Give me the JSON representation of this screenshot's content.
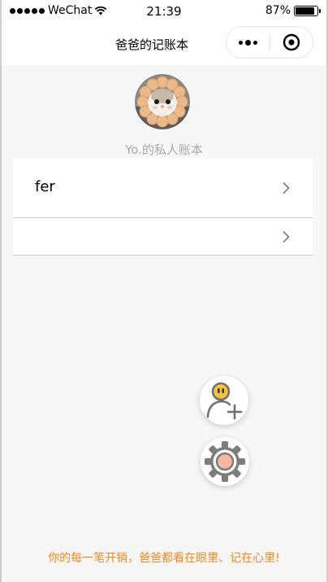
{
  "status_bar": {
    "carrier": "WeChat",
    "time": "21:39",
    "battery_text": "87%",
    "battery_level": 0.87,
    "signal_icon": "signal-dots-icon",
    "wifi_icon": "wifi-icon",
    "battery_icon": "battery-icon"
  },
  "nav": {
    "title": "爸爸的记账本",
    "more_icon": "more-dots-icon",
    "close_icon": "mini-program-close-icon"
  },
  "profile": {
    "avatar_icon": "hamster-avatar",
    "name": "Yo.的私人账本"
  },
  "list": {
    "items": [
      {
        "label": "fer",
        "icon": "chevron-right-icon"
      },
      {
        "label": "",
        "icon": "chevron-right-icon"
      }
    ]
  },
  "actions": {
    "add_member_icon": "add-user-icon",
    "settings_icon": "gear-icon"
  },
  "footer": {
    "slogan": "你的每一笔开销，爸爸都看在眼里、记在心里!"
  },
  "colors": {
    "background": "#f7f7f7",
    "card": "#ffffff",
    "muted_text": "#a9a9a9",
    "slogan": "#f08a24",
    "icon_gray": "#6f6f6f",
    "avatar_accent": "#f5c542",
    "gear_center": "#f7b8a2"
  }
}
